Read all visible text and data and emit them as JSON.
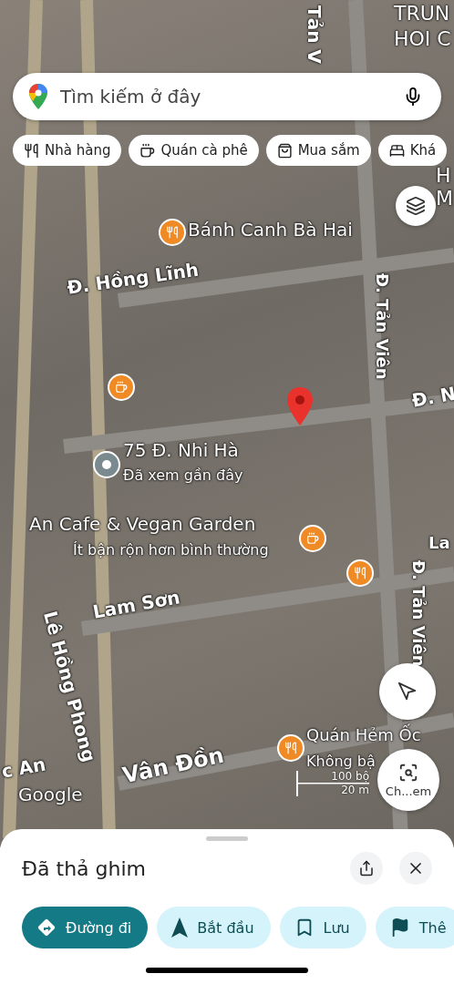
{
  "search": {
    "placeholder": "Tìm kiếm ở đây"
  },
  "chips": [
    {
      "label": "Nhà hàng",
      "kind": "restaurant"
    },
    {
      "label": "Quán cà phê",
      "kind": "cafe"
    },
    {
      "label": "Mua sắm",
      "kind": "shopping"
    },
    {
      "label": "Khá",
      "kind": "hotel"
    }
  ],
  "map": {
    "labels": [
      {
        "text": "TRUN",
        "kind": "area"
      },
      {
        "text": "HOI C",
        "kind": "area"
      },
      {
        "text": "Tản V",
        "kind": "street"
      },
      {
        "text": "Bánh Canh Bà Hai",
        "kind": "place"
      },
      {
        "text": "Đ. Hồng Lĩnh",
        "kind": "street"
      },
      {
        "text": "Đ. Tản Viên",
        "kind": "street"
      },
      {
        "text": "Đ. N",
        "kind": "street"
      },
      {
        "text": "75 Đ. Nhi Hà",
        "kind": "place"
      },
      {
        "text": "Đã xem gần đây",
        "kind": "subtitle"
      },
      {
        "text": "An Cafe & Vegan Garden",
        "kind": "place"
      },
      {
        "text": "Ít bận rộn hơn bình thường",
        "kind": "subtitle"
      },
      {
        "text": "La",
        "kind": "street"
      },
      {
        "text": "Lam Sơn",
        "kind": "street"
      },
      {
        "text": "Đ. Tản Viên",
        "kind": "street"
      },
      {
        "text": "Lê Hồng Phong",
        "kind": "street"
      },
      {
        "text": "Vân Đồn",
        "kind": "street"
      },
      {
        "text": "c An",
        "kind": "street"
      },
      {
        "text": "Google",
        "kind": "place"
      },
      {
        "text": "Quán Hẻm Ốc",
        "kind": "place"
      },
      {
        "text": "Không bậ",
        "kind": "subtitle"
      },
      {
        "text": "H",
        "kind": "area"
      },
      {
        "text": "M",
        "kind": "area"
      }
    ],
    "markers": [
      {
        "kind": "restaurant"
      },
      {
        "kind": "cafe"
      },
      {
        "kind": "visited"
      },
      {
        "kind": "dropped"
      },
      {
        "kind": "cafe"
      },
      {
        "kind": "restaurant"
      },
      {
        "kind": "restaurant"
      }
    ],
    "scale": {
      "top": "100 bộ",
      "bottom": "20 m"
    },
    "lens_button": {
      "label": "Ch...em"
    }
  },
  "sheet": {
    "title": "Đã thả ghim",
    "actions": [
      {
        "label": "Đường đi",
        "kind": "directions",
        "primary": true
      },
      {
        "label": "Bắt đầu",
        "kind": "start",
        "primary": false
      },
      {
        "label": "Lưu",
        "kind": "save",
        "primary": false
      },
      {
        "label": "Thê",
        "kind": "flag",
        "primary": false
      }
    ]
  }
}
